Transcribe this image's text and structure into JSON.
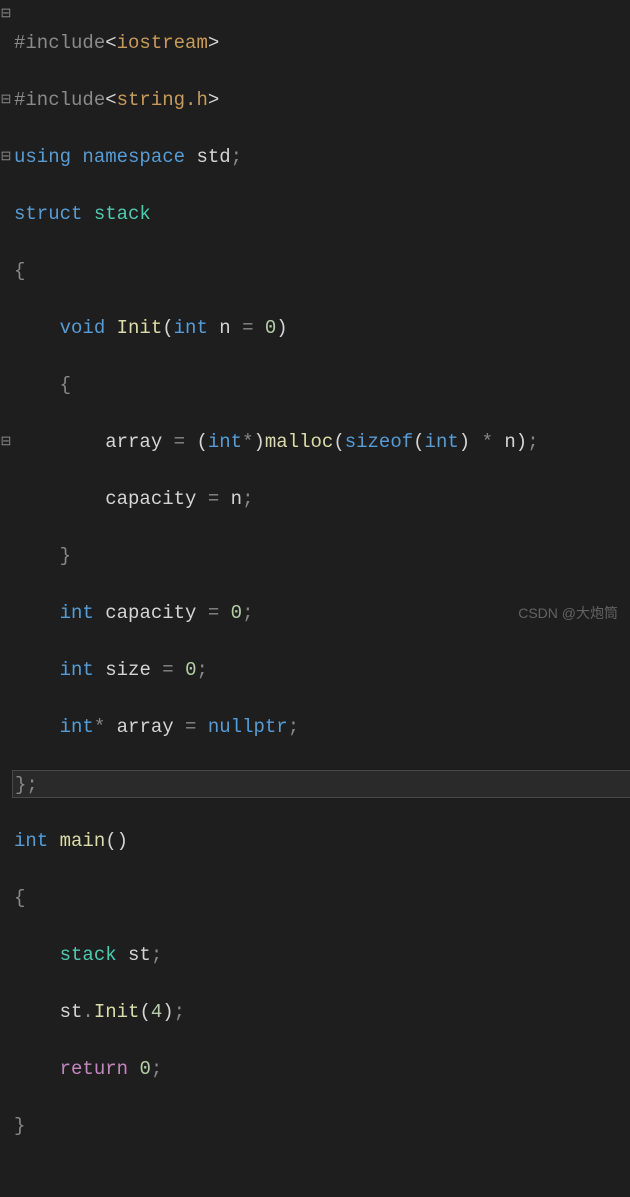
{
  "gutter": {
    "markers": [
      "⊟",
      "",
      "",
      "⊟",
      "",
      "⊟",
      "",
      "",
      "",
      "",
      "",
      "",
      "",
      "",
      "",
      "⊟",
      "",
      "",
      "",
      "",
      ""
    ]
  },
  "code": {
    "l1": {
      "pre": "#include",
      "open": "<",
      "path": "iostream",
      "close": ">"
    },
    "l2": {
      "pre": "#include",
      "open": "<",
      "path": "string.h",
      "close": ">"
    },
    "l3": {
      "kw1": "using",
      "kw2": "namespace",
      "id": "std",
      "sc": ";"
    },
    "l4": {
      "kw": "struct",
      "type": "stack"
    },
    "l5": {
      "brace": "{"
    },
    "l6": {
      "indent": "    ",
      "kw": "void",
      "fn": "Init",
      "p1": "(",
      "ptype": "int",
      "pname": "n",
      "eq": " = ",
      "num": "0",
      "p2": ")"
    },
    "l7": {
      "indent": "    ",
      "brace": "{"
    },
    "l8": {
      "indent": "        ",
      "id": "array",
      "eq": " = ",
      "p1": "(",
      "t1": "int",
      "star": "*",
      "p2": ")",
      "fn": "malloc",
      "p3": "(",
      "kw": "sizeof",
      "p4": "(",
      "t2": "int",
      "p5": ")",
      "mul": " * ",
      "var": "n",
      "p6": ")",
      "sc": ";"
    },
    "l9": {
      "indent": "        ",
      "id": "capacity",
      "eq": " = ",
      "var": "n",
      "sc": ";"
    },
    "l10": {
      "indent": "    ",
      "brace": "}"
    },
    "l11": {
      "indent": "    ",
      "type": "int",
      "id": "capacity",
      "eq": " = ",
      "num": "0",
      "sc": ";"
    },
    "l12": {
      "indent": "    ",
      "type": "int",
      "id": "size",
      "eq": " = ",
      "num": "0",
      "sc": ";"
    },
    "l13": {
      "indent": "    ",
      "type": "int",
      "star": "*",
      "id": "array",
      "eq": " = ",
      "kw": "nullptr",
      "sc": ";"
    },
    "l14": {
      "brace": "};"
    },
    "l15": {
      "type": "int",
      "fn": "main",
      "p": "()"
    },
    "l16": {
      "brace": "{"
    },
    "l17": {
      "indent": "    ",
      "type": "stack",
      "id": "st",
      "sc": ";"
    },
    "l18": {
      "indent": "    ",
      "id": "st",
      "dot": ".",
      "fn": "Init",
      "p1": "(",
      "num": "4",
      "p2": ")",
      "sc": ";"
    },
    "l19": {
      "indent": "    ",
      "kw": "return",
      "num": "0",
      "sc": ";"
    },
    "l20": {
      "brace": "}"
    }
  },
  "watermark": "CSDN @大炮筒"
}
